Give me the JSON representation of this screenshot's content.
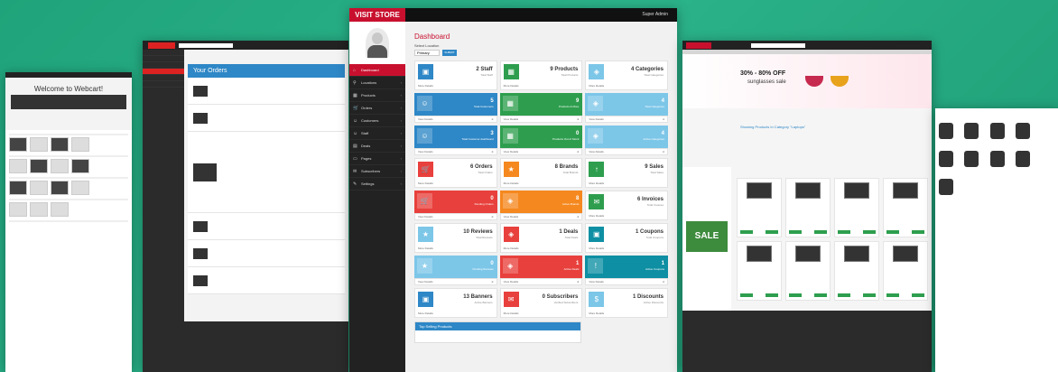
{
  "s1": {
    "welcome": "Welcome to Webcart!"
  },
  "s2": {
    "heading": "Your Orders"
  },
  "app": {
    "brand": "VISIT STORE",
    "user": "Super Admin",
    "page_title": "Dashboard",
    "select_location_label": "Select Location",
    "location_value": "Primary",
    "submit": "SUBMIT",
    "top_selling": "Top Selling Products"
  },
  "nav": [
    {
      "label": "Dashboard",
      "icon": "⌂"
    },
    {
      "label": "Locations",
      "icon": "⚲"
    },
    {
      "label": "Products",
      "icon": "▦"
    },
    {
      "label": "Orders",
      "icon": "🛒"
    },
    {
      "label": "Customers",
      "icon": "☺"
    },
    {
      "label": "Staff",
      "icon": "☺"
    },
    {
      "label": "Deals",
      "icon": "▤"
    },
    {
      "label": "Pages",
      "icon": "▭"
    },
    {
      "label": "Subscribers",
      "icon": "✉"
    },
    {
      "label": "Settings",
      "icon": "✎"
    }
  ],
  "cards": [
    {
      "value": "2 Staff",
      "sub": "Total Staff",
      "foot": "More Details",
      "color": "#2e87c6",
      "icon": "▣",
      "colored": false
    },
    {
      "value": "9 Products",
      "sub": "Total Products",
      "foot": "More Details",
      "color": "#2e9e4e",
      "icon": "▦",
      "colored": false
    },
    {
      "value": "4 Categories",
      "sub": "Total Categories",
      "foot": "More Details",
      "color": "#7cc6e8",
      "icon": "◈",
      "colored": false
    },
    {
      "value": "5",
      "sub": "Total Customers",
      "foot": "View Details",
      "color": "#2e87c6",
      "icon": "☺",
      "colored": true
    },
    {
      "value": "9",
      "sub": "Products & More",
      "foot": "View Details",
      "color": "#2e9e4e",
      "icon": "▦",
      "colored": true
    },
    {
      "value": "4",
      "sub": "Total Categories",
      "foot": "View Details",
      "color": "#7cc6e8",
      "icon": "◈",
      "colored": true
    },
    {
      "value": "3",
      "sub": "Total Customer dashboard",
      "foot": "View Details",
      "color": "#2e87c6",
      "icon": "☺",
      "colored": true
    },
    {
      "value": "0",
      "sub": "Products Out of Stock",
      "foot": "View Details",
      "color": "#2e9e4e",
      "icon": "▦",
      "colored": true
    },
    {
      "value": "4",
      "sub": "Active Categories",
      "foot": "View Details",
      "color": "#7cc6e8",
      "icon": "◈",
      "colored": true
    },
    {
      "value": "6 Orders",
      "sub": "Total Orders",
      "foot": "More Details",
      "color": "#e8403c",
      "icon": "🛒",
      "colored": false
    },
    {
      "value": "8 Brands",
      "sub": "Total Brands",
      "foot": "More Details",
      "color": "#f5881f",
      "icon": "★",
      "colored": false
    },
    {
      "value": "9 Sales",
      "sub": "Total Sales",
      "foot": "More Details",
      "color": "#2e9e4e",
      "icon": "↑",
      "colored": false
    },
    {
      "value": "0",
      "sub": "Pending Orders",
      "foot": "View Details",
      "color": "#e8403c",
      "icon": "🛒",
      "colored": true
    },
    {
      "value": "8",
      "sub": "Active Brands",
      "foot": "View Details",
      "color": "#f5881f",
      "icon": "◈",
      "colored": true
    },
    {
      "value": "6 Invoices",
      "sub": "Total Invoices",
      "foot": "More Details",
      "color": "#2e9e4e",
      "icon": "✉",
      "colored": false
    },
    {
      "value": "10 Reviews",
      "sub": "Total Reviews",
      "foot": "More Details",
      "color": "#7cc6e8",
      "icon": "★",
      "colored": false
    },
    {
      "value": "1 Deals",
      "sub": "Total Deals",
      "foot": "More Details",
      "color": "#e8403c",
      "icon": "◈",
      "colored": false
    },
    {
      "value": "1 Coupons",
      "sub": "Total Coupons",
      "foot": "More Details",
      "color": "#0e8fa3",
      "icon": "▣",
      "colored": false
    },
    {
      "value": "0",
      "sub": "Pending Reviews",
      "foot": "View Details",
      "color": "#7cc6e8",
      "icon": "★",
      "colored": true
    },
    {
      "value": "1",
      "sub": "Active Deals",
      "foot": "View Details",
      "color": "#e8403c",
      "icon": "◈",
      "colored": true
    },
    {
      "value": "1",
      "sub": "Active Coupons",
      "foot": "View Details",
      "color": "#0e8fa3",
      "icon": "!",
      "colored": true
    },
    {
      "value": "13 Banners",
      "sub": "Active Banners",
      "foot": "More Details",
      "color": "#2e87c6",
      "icon": "▣",
      "colored": false
    },
    {
      "value": "0 Subscribers",
      "sub": "Verified Subscribers",
      "foot": "More Details",
      "color": "#e8403c",
      "icon": "✉",
      "colored": false
    },
    {
      "value": "1 Discounts",
      "sub": "Active Discounts",
      "foot": "More Details",
      "color": "#7cc6e8",
      "icon": "$",
      "colored": false
    }
  ],
  "s4": {
    "promo_pct": "30% - 80% OFF",
    "promo_sub": "sunglasses sale",
    "category": "Showing Products In Category \"Laptops\"",
    "sale": "SALE"
  }
}
